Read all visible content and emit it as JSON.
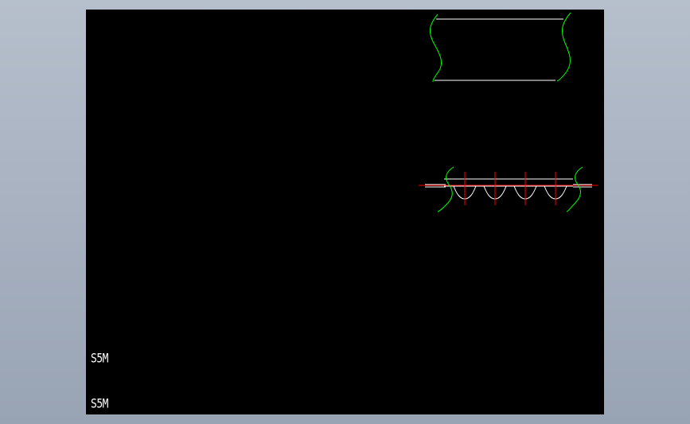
{
  "drawing": {
    "labels": {
      "part_label_1": "S5M",
      "part_label_2": "S5M"
    },
    "colors": {
      "background": "#000000",
      "outline": "#ffffff",
      "break_line": "#00ff00",
      "center_line": "#ff0000",
      "frame": "#a6b0bf"
    }
  }
}
